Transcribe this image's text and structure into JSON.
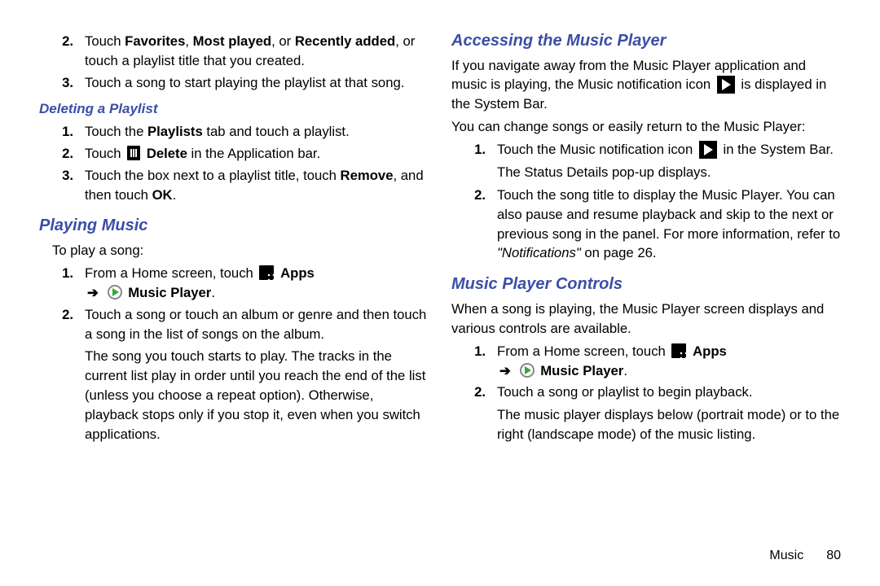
{
  "footer": {
    "section": "Music",
    "page": "80"
  },
  "left": {
    "topSteps": [
      {
        "n": "2.",
        "pre": "Touch ",
        "bold": "Favorites",
        "mid": ", ",
        "bold2": "Most played",
        "mid2": ", or ",
        "bold3": "Recently added",
        "post": ", or touch a playlist title that you created."
      },
      {
        "n": "3.",
        "text": "Touch a song to start playing the playlist at that song."
      }
    ],
    "delHeading": "Deleting a Playlist",
    "delSteps": {
      "s1": {
        "n": "1.",
        "pre": "Touch the ",
        "bold": "Playlists",
        "post": " tab and touch a playlist."
      },
      "s2": {
        "n": "2.",
        "pre": "Touch ",
        "boldAfterIcon": "Delete",
        "post": " in the Application bar."
      },
      "s3": {
        "n": "3.",
        "pre": "Touch the box next to a playlist title, touch ",
        "bold": "Remove",
        "mid": ", and then touch ",
        "bold2": "OK",
        "post": "."
      }
    },
    "playHeading": "Playing Music",
    "playIntro": "To play a song:",
    "playSteps": {
      "s1": {
        "n": "1.",
        "pre": "From a Home screen, touch",
        "apps": "Apps",
        "arrow": "➔",
        "mp": "Music Player",
        "post": "."
      },
      "s2": {
        "n": "2.",
        "text": "Touch a song or touch an album or genre and then touch a song in the list of songs on the album."
      },
      "follow": "The song you touch starts to play. The tracks in the current list play in order until you reach the end of the list (unless you choose a repeat option). Otherwise, playback stops only if you stop it, even when you switch applications."
    }
  },
  "right": {
    "accHeading": "Accessing the Music Player",
    "accP1a": "If you navigate away from the Music Player application and music is playing, the Music notification icon",
    "accP1b": "is displayed in the System Bar.",
    "accP2": "You can change songs or easily return to the Music Player:",
    "accSteps": {
      "s1": {
        "n": "1.",
        "pre": "Touch the Music notification icon",
        "post": "in the System Bar."
      },
      "follow1": "The Status Details pop-up displays.",
      "s2": {
        "n": "2.",
        "pre": "Touch the song title to display the Music Player. You can also pause and resume playback and skip to the next or previous song in the panel. For more information, refer to ",
        "ital": "\"Notifications\"",
        "post": " on page 26."
      }
    },
    "ctrlHeading": "Music Player Controls",
    "ctrlP": "When a song is playing, the Music Player screen displays and various controls are available.",
    "ctrlSteps": {
      "s1": {
        "n": "1.",
        "pre": "From a Home screen, touch",
        "apps": "Apps",
        "arrow": "➔",
        "mp": "Music Player",
        "post": "."
      },
      "s2": {
        "n": "2.",
        "text": "Touch a song or playlist to begin playback."
      },
      "follow": "The music player displays below (portrait mode) or to the right (landscape mode) of the music listing."
    }
  }
}
